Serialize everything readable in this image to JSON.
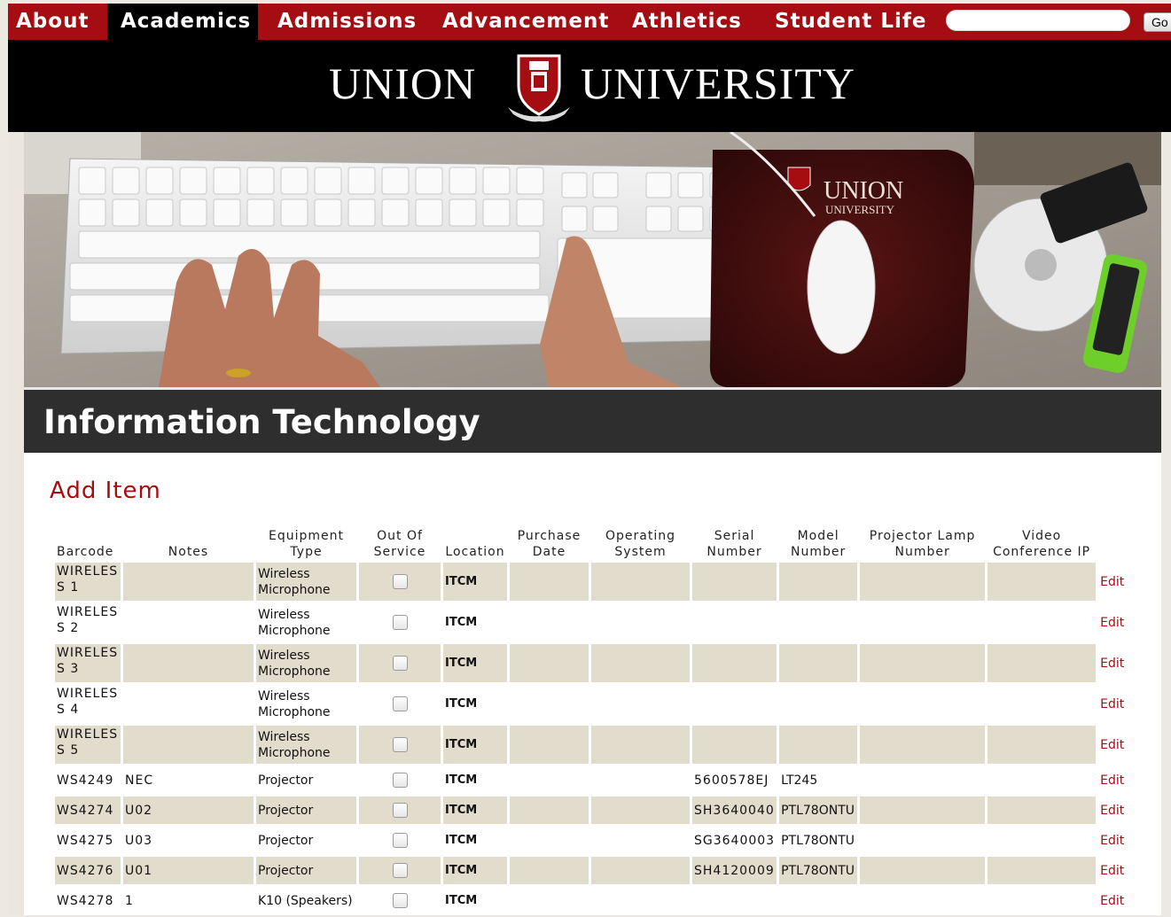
{
  "nav": {
    "items": [
      "About",
      "Academics",
      "Admissions",
      "Advancement",
      "Athletics",
      "Student Life"
    ],
    "active": "Academics",
    "search_value": "",
    "go_label": "Go"
  },
  "header": {
    "left_word": "UNION",
    "right_word": "UNIVERSITY"
  },
  "hero": {
    "mousepad_text_1": "UNION",
    "mousepad_text_2": "UNIVERSITY"
  },
  "page": {
    "title": "Information Technology",
    "section_title": "Add Item"
  },
  "table": {
    "headers": [
      "Barcode",
      "Notes",
      "Equipment Type",
      "Out Of Service",
      "Location",
      "Purchase Date",
      "Operating System",
      "Serial Number",
      "Model Number",
      "Projector Lamp Number",
      "Video Conference IP",
      ""
    ],
    "edit_label": "Edit",
    "rows": [
      {
        "barcode": "WIRELESS 1",
        "notes": "",
        "type": "Wireless Microphone",
        "location": "ITCM",
        "purchase": "",
        "os": "",
        "serial": "",
        "model": "",
        "lamp": "",
        "vcip": ""
      },
      {
        "barcode": "WIRELESS 2",
        "notes": "",
        "type": "Wireless Microphone",
        "location": "ITCM",
        "purchase": "",
        "os": "",
        "serial": "",
        "model": "",
        "lamp": "",
        "vcip": ""
      },
      {
        "barcode": "WIRELESS 3",
        "notes": "",
        "type": "Wireless Microphone",
        "location": "ITCM",
        "purchase": "",
        "os": "",
        "serial": "",
        "model": "",
        "lamp": "",
        "vcip": ""
      },
      {
        "barcode": "WIRELESS 4",
        "notes": "",
        "type": "Wireless Microphone",
        "location": "ITCM",
        "purchase": "",
        "os": "",
        "serial": "",
        "model": "",
        "lamp": "",
        "vcip": ""
      },
      {
        "barcode": "WIRELESS 5",
        "notes": "",
        "type": "Wireless Microphone",
        "location": "ITCM",
        "purchase": "",
        "os": "",
        "serial": "",
        "model": "",
        "lamp": "",
        "vcip": ""
      },
      {
        "barcode": "WS4249",
        "notes": "NEC",
        "type": "Projector",
        "location": "ITCM",
        "purchase": "",
        "os": "",
        "serial": "5600578EJ",
        "model": "LT245",
        "lamp": "",
        "vcip": ""
      },
      {
        "barcode": "WS4274",
        "notes": "U02",
        "type": "Projector",
        "location": "ITCM",
        "purchase": "",
        "os": "",
        "serial": "SH3640040",
        "model": "PTL78ONTU",
        "lamp": "",
        "vcip": ""
      },
      {
        "barcode": "WS4275",
        "notes": "U03",
        "type": "Projector",
        "location": "ITCM",
        "purchase": "",
        "os": "",
        "serial": "SG3640003",
        "model": "PTL78ONTU",
        "lamp": "",
        "vcip": ""
      },
      {
        "barcode": "WS4276",
        "notes": "U01",
        "type": "Projector",
        "location": "ITCM",
        "purchase": "",
        "os": "",
        "serial": "SH4120009",
        "model": "PTL78ONTU",
        "lamp": "",
        "vcip": ""
      },
      {
        "barcode": "WS4278",
        "notes": "1",
        "type": "K10 (Speakers)",
        "location": "ITCM",
        "purchase": "",
        "os": "",
        "serial": "",
        "model": "",
        "lamp": "",
        "vcip": ""
      }
    ]
  },
  "colors": {
    "brand_red": "#a50d12",
    "row_shade": "#e1dccb",
    "title_bar": "#2e2e2e"
  }
}
